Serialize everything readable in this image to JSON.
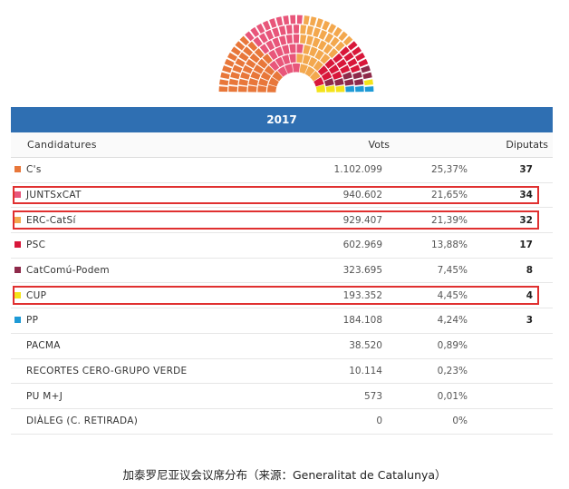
{
  "chart_data": {
    "type": "table",
    "year": "2017",
    "headers": {
      "party": "Candidatures",
      "votes": "Vots",
      "seats": "Diputats"
    },
    "rows": [
      {
        "party": "C's",
        "votes": "1.102.099",
        "pct": "25,37%",
        "seats": "37",
        "color": "#e8773a",
        "highlight": false
      },
      {
        "party": "JUNTSxCAT",
        "votes": "940.602",
        "pct": "21,65%",
        "seats": "34",
        "color": "#e8567a",
        "highlight": true
      },
      {
        "party": "ERC-CatSí",
        "votes": "929.407",
        "pct": "21,39%",
        "seats": "32",
        "color": "#f3a84e",
        "highlight": true
      },
      {
        "party": "PSC",
        "votes": "602.969",
        "pct": "13,88%",
        "seats": "17",
        "color": "#d8173a",
        "highlight": false
      },
      {
        "party": "CatComú-Podem",
        "votes": "323.695",
        "pct": "7,45%",
        "seats": "8",
        "color": "#8e2a4a",
        "highlight": false
      },
      {
        "party": "CUP",
        "votes": "193.352",
        "pct": "4,45%",
        "seats": "4",
        "color": "#f4e31a",
        "highlight": true
      },
      {
        "party": "PP",
        "votes": "184.108",
        "pct": "4,24%",
        "seats": "3",
        "color": "#1e9ad6",
        "highlight": false
      },
      {
        "party": "PACMA",
        "votes": "38.520",
        "pct": "0,89%",
        "seats": "",
        "color": "",
        "highlight": false
      },
      {
        "party": "RECORTES CERO-GRUPO VERDE",
        "votes": "10.114",
        "pct": "0,23%",
        "seats": "",
        "color": "",
        "highlight": false
      },
      {
        "party": "PU M+J",
        "votes": "573",
        "pct": "0,01%",
        "seats": "",
        "color": "",
        "highlight": false
      },
      {
        "party": "DIÀLEG (C. RETIRADA)",
        "votes": "0",
        "pct": "0%",
        "seats": "",
        "color": "",
        "highlight": false
      }
    ],
    "hemicycle": {
      "type": "parliament",
      "series": [
        {
          "name": "C's",
          "seats": 37,
          "color": "#e8773a"
        },
        {
          "name": "JUNTSxCAT",
          "seats": 34,
          "color": "#e8567a"
        },
        {
          "name": "ERC-CatSí",
          "seats": 32,
          "color": "#f3a84e"
        },
        {
          "name": "PSC",
          "seats": 17,
          "color": "#d8173a"
        },
        {
          "name": "CatComú-Podem",
          "seats": 8,
          "color": "#8e2a4a"
        },
        {
          "name": "CUP",
          "seats": 4,
          "color": "#f4e31a"
        },
        {
          "name": "PP",
          "seats": 3,
          "color": "#1e9ad6"
        }
      ]
    }
  },
  "caption": "加泰罗尼亚议会议席分布（来源：Generalitat de Catalunya）"
}
